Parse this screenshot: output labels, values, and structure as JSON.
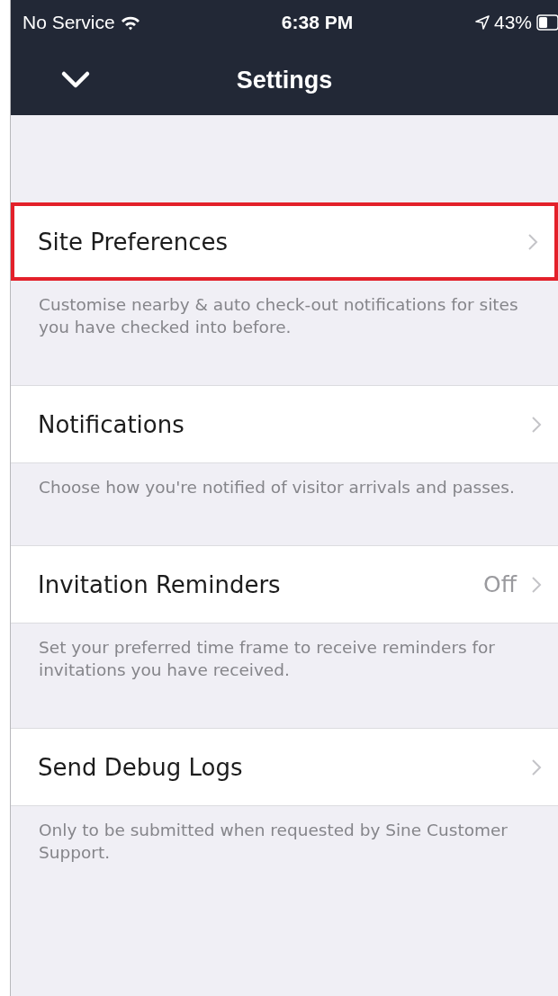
{
  "status_bar": {
    "carrier": "No Service",
    "time": "6:38 PM",
    "battery": "43%"
  },
  "nav_bar": {
    "title": "Settings"
  },
  "sections": [
    {
      "label": "Site Preferences",
      "selected": true,
      "footer": "Customise nearby & auto check-out notifications for sites you have checked into before."
    },
    {
      "label": "Notifications",
      "selected": false,
      "footer": "Choose how you're notified of visitor arrivals and passes."
    },
    {
      "label": "Invitation Reminders",
      "selected": false,
      "value": "Off",
      "footer": "Set your preferred time frame to receive reminders for invitations you have received."
    },
    {
      "label": "Send Debug Logs",
      "selected": false,
      "footer": "Only to be submitted when requested by Sine Customer Support."
    }
  ]
}
